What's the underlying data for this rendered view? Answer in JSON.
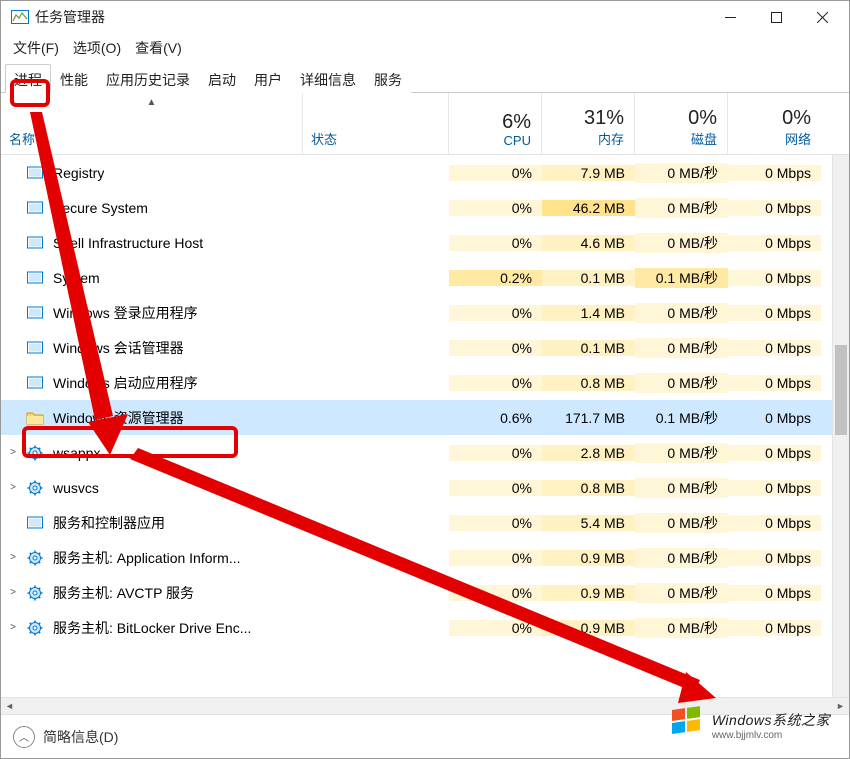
{
  "window": {
    "title": "任务管理器"
  },
  "menu": {
    "file": "文件(F)",
    "options": "选项(O)",
    "view": "查看(V)"
  },
  "tabs": [
    "进程",
    "性能",
    "应用历史记录",
    "启动",
    "用户",
    "详细信息",
    "服务"
  ],
  "columns": {
    "name": "名称",
    "status": "状态",
    "cpu": {
      "pct": "6%",
      "label": "CPU"
    },
    "mem": {
      "pct": "31%",
      "label": "内存"
    },
    "disk": {
      "pct": "0%",
      "label": "磁盘"
    },
    "net": {
      "pct": "0%",
      "label": "网络"
    }
  },
  "rows": [
    {
      "icon": "sys",
      "name": "Registry",
      "cpu": "0%",
      "mem": "7.9 MB",
      "disk": "0 MB/秒",
      "net": "0 Mbps",
      "expand": false
    },
    {
      "icon": "sys",
      "name": "Secure System",
      "cpu": "0%",
      "mem": "46.2 MB",
      "disk": "0 MB/秒",
      "net": "0 Mbps",
      "expand": false,
      "mem_md": true
    },
    {
      "icon": "sys",
      "name": "Shell Infrastructure Host",
      "cpu": "0%",
      "mem": "4.6 MB",
      "disk": "0 MB/秒",
      "net": "0 Mbps",
      "expand": false
    },
    {
      "icon": "sys",
      "name": "System",
      "cpu": "0.2%",
      "mem": "0.1 MB",
      "disk": "0.1 MB/秒",
      "net": "0 Mbps",
      "expand": false,
      "cpu_md": true,
      "disk_md": true
    },
    {
      "icon": "sys",
      "name": "Windows 登录应用程序",
      "cpu": "0%",
      "mem": "1.4 MB",
      "disk": "0 MB/秒",
      "net": "0 Mbps",
      "expand": false
    },
    {
      "icon": "sys",
      "name": "Windows 会话管理器",
      "cpu": "0%",
      "mem": "0.1 MB",
      "disk": "0 MB/秒",
      "net": "0 Mbps",
      "expand": false
    },
    {
      "icon": "sys",
      "name": "Windows 启动应用程序",
      "cpu": "0%",
      "mem": "0.8 MB",
      "disk": "0 MB/秒",
      "net": "0 Mbps",
      "expand": false
    },
    {
      "icon": "exp",
      "name": "Windows 资源管理器",
      "cpu": "0.6%",
      "mem": "171.7 MB",
      "disk": "0.1 MB/秒",
      "net": "0 Mbps",
      "expand": false,
      "selected": true
    },
    {
      "icon": "gear",
      "name": "wsappx",
      "cpu": "0%",
      "mem": "2.8 MB",
      "disk": "0 MB/秒",
      "net": "0 Mbps",
      "expand": true
    },
    {
      "icon": "gear",
      "name": "wusvcs",
      "cpu": "0%",
      "mem": "0.8 MB",
      "disk": "0 MB/秒",
      "net": "0 Mbps",
      "expand": true
    },
    {
      "icon": "sys",
      "name": "服务和控制器应用",
      "cpu": "0%",
      "mem": "5.4 MB",
      "disk": "0 MB/秒",
      "net": "0 Mbps",
      "expand": false
    },
    {
      "icon": "gear",
      "name": "服务主机: Application Inform...",
      "cpu": "0%",
      "mem": "0.9 MB",
      "disk": "0 MB/秒",
      "net": "0 Mbps",
      "expand": true
    },
    {
      "icon": "gear",
      "name": "服务主机: AVCTP 服务",
      "cpu": "0%",
      "mem": "0.9 MB",
      "disk": "0 MB/秒",
      "net": "0 Mbps",
      "expand": true
    },
    {
      "icon": "gear",
      "name": "服务主机: BitLocker Drive Enc...",
      "cpu": "0%",
      "mem": "0.9 MB",
      "disk": "0 MB/秒",
      "net": "0 Mbps",
      "expand": true
    }
  ],
  "footer": {
    "collapse": "简略信息(D)"
  },
  "watermark": {
    "line1": "Windows系统之家",
    "line2": "www.bjjmlv.com"
  }
}
